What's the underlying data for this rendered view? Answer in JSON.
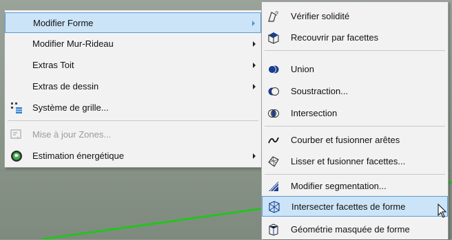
{
  "main_menu": {
    "items": [
      {
        "label": "Modifier Forme",
        "icon": "none"
      },
      {
        "label": "Modifier Mur-Rideau",
        "icon": "none"
      },
      {
        "label": "Extras Toit",
        "icon": "none"
      },
      {
        "label": "Extras de dessin",
        "icon": "none"
      },
      {
        "label": "Système de grille...",
        "icon": "grid-system-icon"
      },
      {
        "label": "Mise à jour Zones...",
        "icon": "update-zones-icon"
      },
      {
        "label": "Estimation énergétique",
        "icon": "energy-globe-icon"
      }
    ]
  },
  "sub_menu": {
    "items": [
      {
        "label": "Vérifier solidité",
        "icon": "check-solidity-icon"
      },
      {
        "label": "Recouvrir par facettes",
        "icon": "cover-facets-icon"
      },
      {
        "label": "Union",
        "icon": "union-icon"
      },
      {
        "label": "Soustraction...",
        "icon": "subtraction-icon"
      },
      {
        "label": "Intersection",
        "icon": "intersection-icon"
      },
      {
        "label": "Courber et fusionner arêtes",
        "icon": "curve-edges-icon"
      },
      {
        "label": "Lisser et fusionner facettes...",
        "icon": "smooth-facets-icon"
      },
      {
        "label": "Modifier segmentation...",
        "icon": "segmentation-icon"
      },
      {
        "label": "Intersecter facettes de forme",
        "icon": "intersect-facets-icon"
      },
      {
        "label": "Géométrie masquée de forme",
        "icon": "hidden-geometry-icon"
      }
    ]
  },
  "colors": {
    "selection_bg": "#cce4f7",
    "selection_border": "#5a9bd5",
    "viewport_line": "#22c41e",
    "shape_blue": "#1a3d8f"
  }
}
